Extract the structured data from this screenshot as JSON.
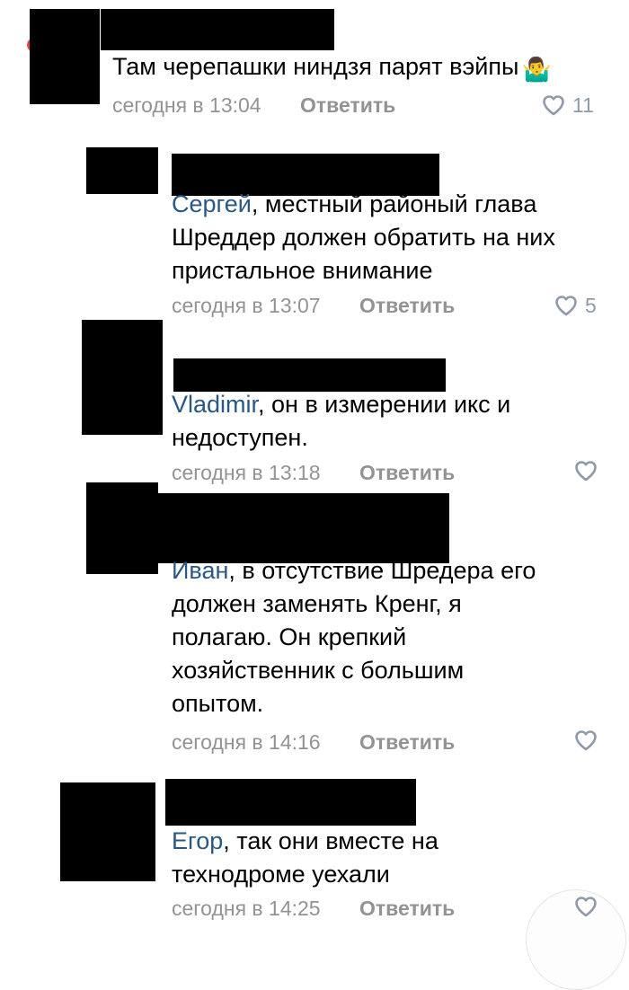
{
  "comments": [
    {
      "mention": "",
      "text": "Там черепашки ниндзя парят вэйпы",
      "emoji": "🤷‍♂️",
      "time": "сегодня в 13:04",
      "reply_label": "Ответить",
      "likes": "11"
    },
    {
      "mention": "Сергей",
      "text": ", местный районый глава Шреддер должен обратить на них пристальное внимание",
      "time": "сегодня в 13:07",
      "reply_label": "Ответить",
      "likes": "5"
    },
    {
      "mention": "Vladimir",
      "text": ", он в измерении икс и недоступен.",
      "time": "сегодня в 13:18",
      "reply_label": "Ответить",
      "likes": ""
    },
    {
      "mention": "Иван",
      "text": ", в отсутствие Шредера его должен заменять Кренг, я полагаю. Он крепкий хозяйственник с большим опытом.",
      "time": "сегодня в 14:16",
      "reply_label": "Ответить",
      "likes": ""
    },
    {
      "mention": "Егор",
      "text": ", так они вместе на технодроме уехали",
      "time": "сегодня в 14:25",
      "reply_label": "Ответить",
      "likes": ""
    }
  ],
  "colors": {
    "mention": "#2a5885",
    "meta": "#939393",
    "like_icon": "#8f9aa8",
    "redaction": "#000000"
  },
  "icons": {
    "like": "heart-outline-icon"
  }
}
